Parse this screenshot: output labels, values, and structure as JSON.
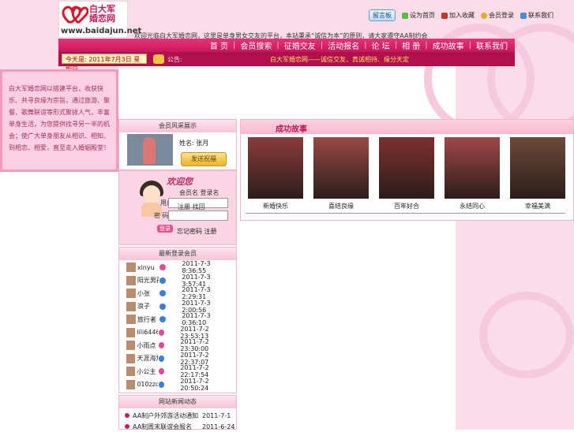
{
  "logo": {
    "brand_line1": "白大军",
    "brand_line2": "婚恋网",
    "url": "www.baidajun.net"
  },
  "top_links": {
    "guestbook": "留言板",
    "items": [
      "设为首页",
      "加入收藏",
      "会员登录",
      "联系我们"
    ]
  },
  "marquee": "欢迎光临白大军婚恋网，这里是单身男女交友的平台，本站秉承“诚信为本”的原则，请大家遵守AA制约会",
  "nav": [
    "首 页",
    "会员搜索",
    "征婚交友",
    "活动报名",
    "论 坛",
    "相 册",
    "成功故事",
    "联系我们"
  ],
  "subbar": {
    "date": "今天是: 2011年7月3日  星期日",
    "notice_label": "公告:",
    "notice": "白大军婚恋网——诚信交友、真诚相待、缘分天定"
  },
  "intro_text": "白大军婚恋网以搭建平台，收获快乐、共寻良缘为宗旨，通过旅游、聚餐、歌舞联谊等形式聚拢人气，丰富单身生活，为您提供找寻另一半的机会；使广大单身朋友从相识、相知、到相恋、相爱，直至走入婚姻殿堂！",
  "member_panel": {
    "title": "会员风采展示",
    "name": "姓名: 张月",
    "bless_btn": "发送祝福"
  },
  "login": {
    "welcome": "欢迎您",
    "status": "会员名 登录名",
    "user_label": "用户名",
    "pass_label": "密 码",
    "hint": "注册  找回",
    "login_btn": "登录",
    "links": "忘记密码  注册"
  },
  "online": {
    "title": "最新登录会员",
    "rows": [
      {
        "name": "xinyu",
        "gender": "f",
        "time": "2011-7-3 8:36:55"
      },
      {
        "name": "阳光男孩",
        "gender": "m",
        "time": "2011-7-3 3:57:41"
      },
      {
        "name": "小张",
        "gender": "m",
        "time": "2011-7-3 2:29:31"
      },
      {
        "name": "浪子",
        "gender": "m",
        "time": "2011-7-3 2:00:56"
      },
      {
        "name": "旅行者",
        "gender": "m",
        "time": "2011-7-3 0:36:10"
      },
      {
        "name": "lili6446",
        "gender": "f",
        "time": "2011-7-2 23:53:13"
      },
      {
        "name": "小雨点",
        "gender": "f",
        "time": "2011-7-2 23:30:00"
      },
      {
        "name": "天涯海角",
        "gender": "m",
        "time": "2011-7-2 22:37:07"
      },
      {
        "name": "小公主",
        "gender": "f",
        "time": "2011-7-2 22:17:54"
      },
      {
        "name": "010zzd",
        "gender": "m",
        "time": "2011-7-2 20:50:24"
      }
    ]
  },
  "news": {
    "title": "网站新闻动态",
    "rows": [
      {
        "text": "AA制户外郊游活动通知",
        "date": "2011-7-1"
      },
      {
        "text": "AA制周末联谊会报名",
        "date": "2011-6-24"
      }
    ]
  },
  "stories": {
    "tab": "成功故事",
    "items": [
      {
        "caption": "新婚快乐",
        "color": "#8b3c3c"
      },
      {
        "caption": "喜结良缘",
        "color": "#9a4a45"
      },
      {
        "caption": "百年好合",
        "color": "#7e2f2f"
      },
      {
        "caption": "永结同心",
        "color": "#a04848"
      },
      {
        "caption": "幸福美满",
        "color": "#6e4a3a"
      }
    ]
  },
  "colors": {
    "nav": "#d91f6a",
    "subbar": "#b0104b",
    "pink_bg": "#fbdde9"
  }
}
